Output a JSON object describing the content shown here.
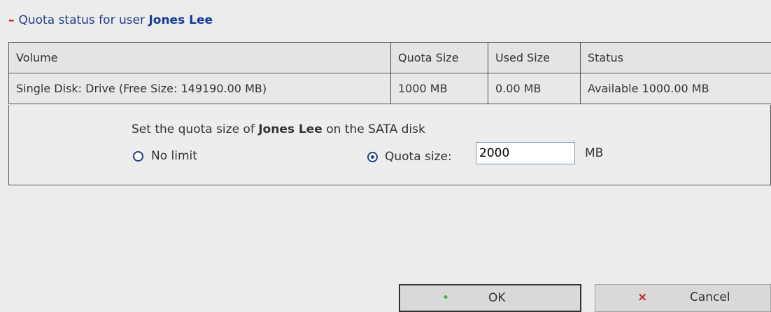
{
  "header": {
    "toggle": "–",
    "prefix": "Quota status for user",
    "username": "Jones Lee"
  },
  "table": {
    "columns": [
      "Volume",
      "Quota Size",
      "Used Size",
      "Status"
    ],
    "rows": [
      [
        "Single Disk: Drive (Free Size: 149190.00 MB)",
        "1000 MB",
        "0.00 MB",
        "Available 1000.00 MB"
      ]
    ]
  },
  "settings": {
    "label_prefix": "Set the quota size of",
    "label_user": "Jones Lee",
    "label_suffix": "on the SATA disk",
    "no_limit_label": "No limit",
    "quota_label": "Quota size:",
    "quota_value": "2000",
    "unit": "MB",
    "selected": "quota"
  },
  "buttons": {
    "ok_icon": "•",
    "ok_label": "OK",
    "cancel_icon": "×",
    "cancel_label": "Cancel"
  },
  "colors": {
    "header_text": "#1f3c8a",
    "toggle": "#d01818",
    "ok_icon": "#22c11f",
    "cancel_icon": "#d02020"
  }
}
